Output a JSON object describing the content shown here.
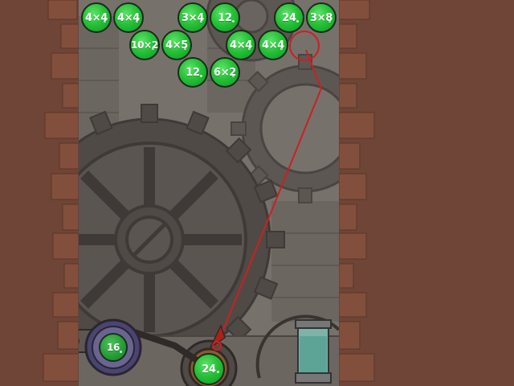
{
  "game": {
    "bubbles": [
      {
        "id": "b1",
        "label": "4×4"
      },
      {
        "id": "b2",
        "label": "4×4"
      },
      {
        "id": "b3",
        "label": "3×4"
      },
      {
        "id": "b4",
        "label": "12"
      },
      {
        "id": "b5",
        "label": "24"
      },
      {
        "id": "b6",
        "label": "3×8"
      },
      {
        "id": "b7",
        "label": "10×2"
      },
      {
        "id": "b8",
        "label": "4×5"
      },
      {
        "id": "b9",
        "label": "4×4"
      },
      {
        "id": "b10",
        "label": "4×4"
      },
      {
        "id": "b11",
        "label": "12"
      },
      {
        "id": "b12",
        "label": "6×2"
      }
    ],
    "current_bubble": {
      "label": "24"
    },
    "next_bubble": {
      "label": "16"
    },
    "colors": {
      "bubble_green": "#27c238",
      "aim_line": "#cc2020",
      "brick": "#6e4536",
      "playfield": "#77716c"
    }
  }
}
